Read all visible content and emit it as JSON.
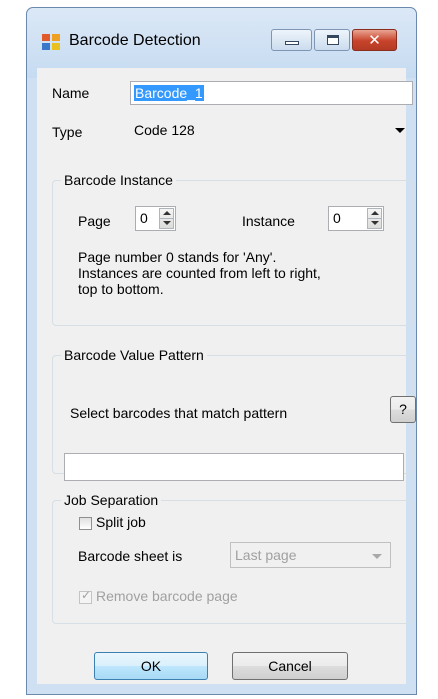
{
  "window": {
    "title": "Barcode Detection",
    "close_glyph": "✕",
    "colors": {
      "title_bg": "#c6dbf1",
      "client_bg": "#f0f0f0",
      "close_red": "#c7432a",
      "selection": "#3399ff"
    }
  },
  "fields": {
    "name_label": "Name",
    "name_value": "Barcode_1",
    "type_label": "Type",
    "type_value": "Code 128"
  },
  "barcode_instance": {
    "title": "Barcode Instance",
    "page_label": "Page",
    "page_value": "0",
    "instance_label": "Instance",
    "instance_value": "0",
    "hint_lines": [
      "Page number 0 stands for 'Any'.",
      "Instances are counted from left to right,",
      "top to bottom."
    ]
  },
  "value_pattern": {
    "title": "Barcode Value Pattern",
    "description": "Select barcodes that match pattern",
    "help_label": "?",
    "pattern_value": ""
  },
  "job_separation": {
    "title": "Job Separation",
    "split_job_label": "Split job",
    "split_job_checked": false,
    "barcode_sheet_label": "Barcode sheet is",
    "barcode_sheet_value": "Last page",
    "remove_page_label": "Remove barcode page",
    "remove_page_checked": true,
    "check_glyph": "✓"
  },
  "buttons": {
    "ok": "OK",
    "cancel": "Cancel"
  }
}
